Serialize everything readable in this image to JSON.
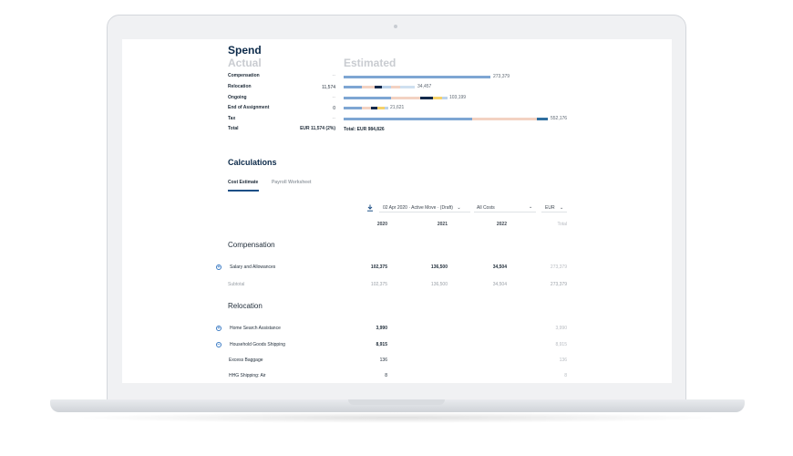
{
  "spend": {
    "title": "Spend",
    "actual_label": "Actual",
    "estimated_label": "Estimated",
    "rows": [
      {
        "label": "Compensation",
        "actual": "--",
        "estimated": "273,379"
      },
      {
        "label": "Relocation",
        "actual": "11,574",
        "estimated": "34,457"
      },
      {
        "label": "Ongoing",
        "actual": "--",
        "estimated": "103,199"
      },
      {
        "label": "End of Assignment",
        "actual": "0",
        "estimated": "21,621"
      },
      {
        "label": "Tax",
        "actual": "--",
        "estimated": "552,176"
      },
      {
        "label": "Total",
        "actual": "EUR 11,574 (2%)",
        "estimated": "Total: EUR 984,826"
      }
    ]
  },
  "bar_colors": {
    "blue": "#7ea6d3",
    "peach": "#f3d2c2",
    "navy": "#13294b",
    "yellow": "#f6d26b",
    "light": "#bcd3ea",
    "teal": "#2f6f9f"
  },
  "calculations": {
    "title": "Calculations",
    "tabs": [
      "Cost Estimate",
      "Payroll Worksheet"
    ],
    "active_tab": "Cost Estimate"
  },
  "filters": {
    "date_move": "02 Apr 2020 · Active Move · (Draft)",
    "costs": "All Costs",
    "currency": "EUR"
  },
  "icons": {
    "download": "download-icon",
    "expand": "plus-circle-icon",
    "collapse": "minus-circle-icon",
    "chevron": "chevron-down-icon"
  },
  "table": {
    "columns": [
      "2020",
      "2021",
      "2022",
      "Total"
    ],
    "sections": [
      {
        "title": "Compensation",
        "rows": [
          {
            "label": "Salary and Allowances",
            "values": [
              "102,375",
              "136,500",
              "34,504",
              "273,379"
            ]
          }
        ],
        "subtotal": {
          "label": "Subtotal",
          "values": [
            "102,375",
            "136,500",
            "34,504",
            "273,379"
          ]
        }
      },
      {
        "title": "Relocation",
        "rows": [
          {
            "label": "Home Search Assistance",
            "values": [
              "3,990",
              "",
              "",
              "3,990"
            ]
          },
          {
            "label": "Household Goods Shipping",
            "values": [
              "8,915",
              "",
              "",
              "8,915"
            ]
          },
          {
            "label": "Excess Baggage",
            "values": [
              "136",
              "",
              "",
              "136"
            ]
          },
          {
            "label": "HHG Shipping: Air",
            "values": [
              "8",
              "",
              "",
              "8"
            ]
          }
        ]
      }
    ]
  }
}
